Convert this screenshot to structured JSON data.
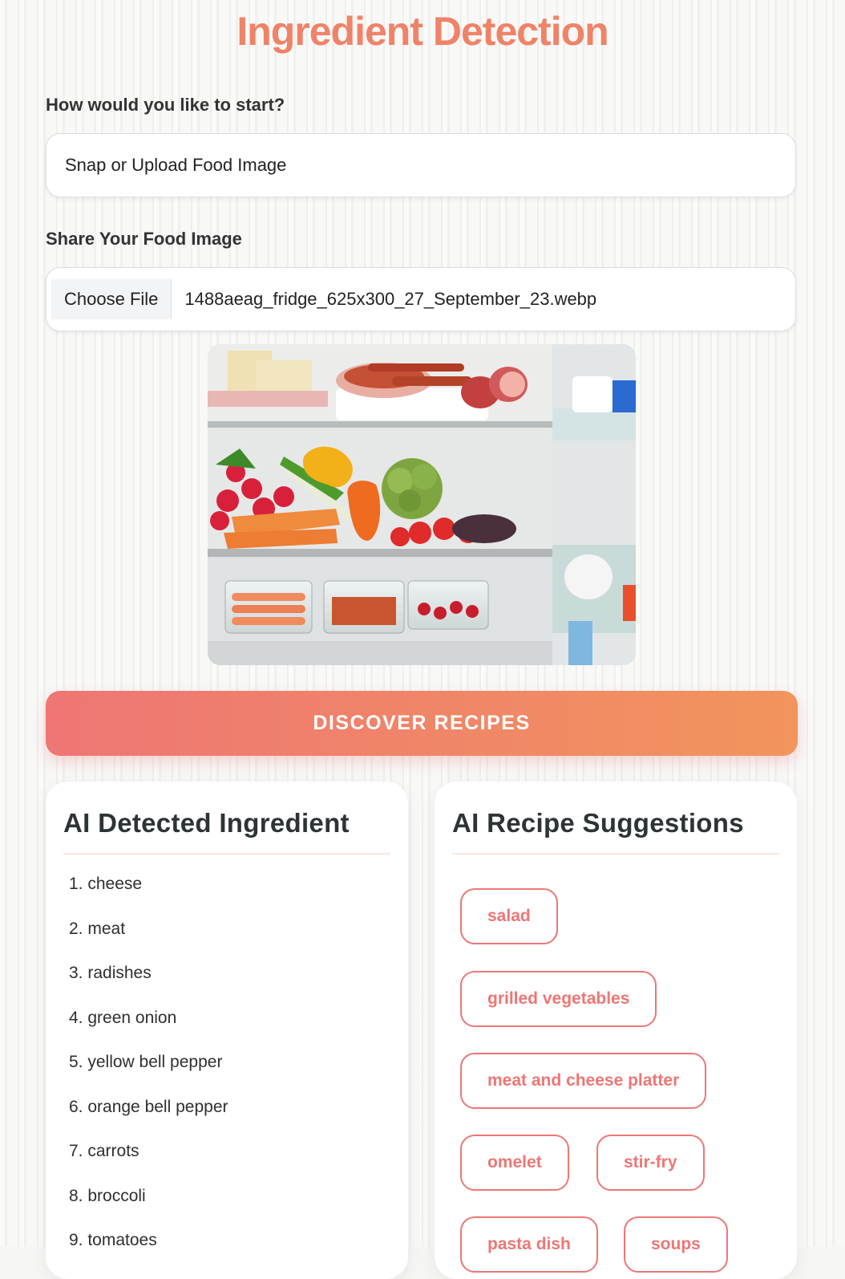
{
  "title": "Ingredient Detection",
  "start": {
    "label": "How would you like to start?",
    "selected": "Snap or Upload Food Image"
  },
  "upload": {
    "label": "Share Your Food Image",
    "button_label": "Choose File",
    "file_name": "1488aeag_fridge_625x300_27_September_23.webp"
  },
  "discover_label": "DISCOVER RECIPES",
  "ingredients": {
    "heading": "AI Detected Ingredient",
    "items": [
      "1. cheese",
      "2. meat",
      "3. radishes",
      "4. green onion",
      "5. yellow bell pepper",
      "6. orange bell pepper",
      "7. carrots",
      "8. broccoli",
      "9. tomatoes"
    ]
  },
  "recipes": {
    "heading": "AI Recipe Suggestions",
    "items": [
      "salad",
      "grilled vegetables",
      "meat and cheese platter",
      "omelet",
      "stir-fry",
      "pasta dish",
      "soups"
    ]
  },
  "colors": {
    "accent": "#ef8368",
    "gradient_start": "#ee7674",
    "gradient_end": "#f2945d"
  }
}
